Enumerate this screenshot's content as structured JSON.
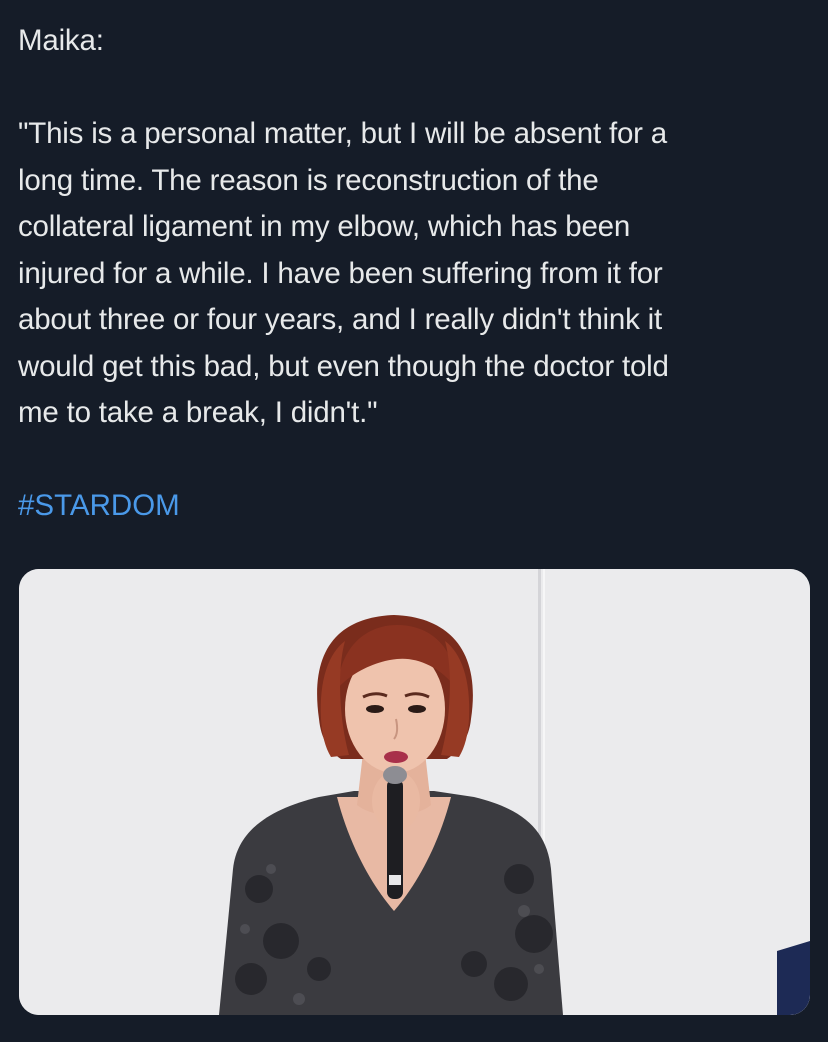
{
  "tweet": {
    "speaker_line": "Maika:",
    "quote_lines": [
      "\"This is a personal matter, but I will be absent for a",
      "long time. The reason is reconstruction of the",
      "collateral ligament in my elbow, which has been",
      "injured for a while. I have been suffering from it for",
      "about three or four years, and I really didn't think it",
      "would get this bad, but even though the doctor told",
      "me to take a break, I didn't.\""
    ],
    "hashtag": "#STARDOM"
  },
  "colors": {
    "background": "#151c28",
    "text": "#e7e9ea",
    "hashtag": "#4a99e9",
    "photo_backdrop": "#ebebed"
  }
}
